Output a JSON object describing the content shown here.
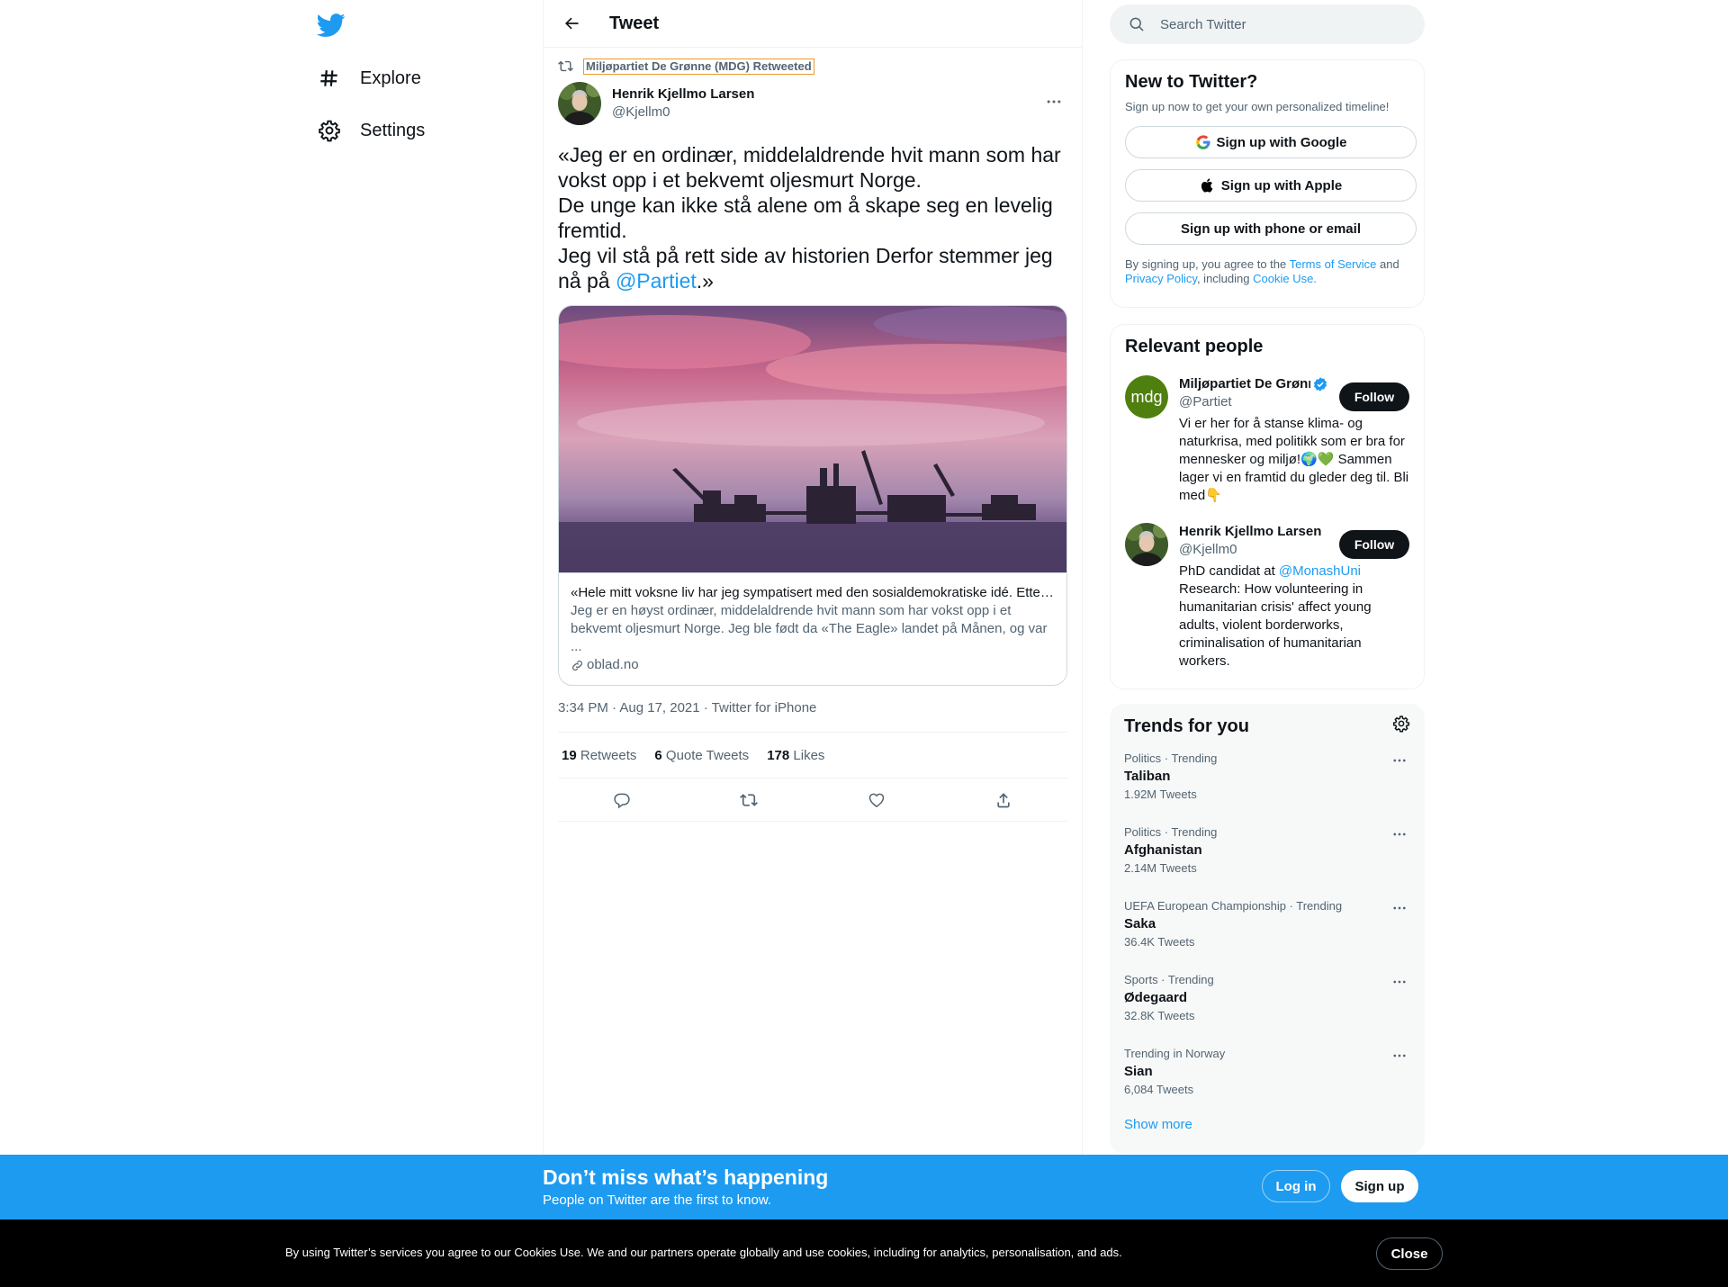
{
  "nav": {
    "explore_label": "Explore",
    "settings_label": "Settings"
  },
  "header": {
    "title": "Tweet"
  },
  "tweet": {
    "retweeted_by": "Miljøpartiet De Grønne (MDG) Retweeted",
    "author_name": "Henrik Kjellmo Larsen",
    "author_handle": "@Kjellm0",
    "text_lines": [
      "«Jeg er en ordinær, middelaldrende hvit mann som har",
      "vokst opp i et bekvemt oljesmurt Norge.",
      "De unge kan ikke stå alene om å skape seg en levelig",
      "fremtid.",
      "Jeg vil stå på rett side av historien Derfor stemmer jeg"
    ],
    "last_line_prefix": "nå på ",
    "mention": "@Partiet",
    "last_line_suffix": ".»",
    "card": {
      "title": "«Hele mitt voksne liv har jeg sympatisert med den sosialdemokratiske idé. Etter...",
      "description_1": "Jeg er en høyst ordinær, middelaldrende hvit mann som har vokst opp i et",
      "description_2": "bekvemt oljesmurt Norge. Jeg ble født da «The Eagle» landet på Månen, og var ...",
      "domain": "oblad.no"
    },
    "timestamp": "3:34 PM · Aug 17, 2021 · Twitter for iPhone",
    "retweets": "19",
    "retweets_label": "Retweets",
    "quotes": "6",
    "quotes_label": "Quote Tweets",
    "likes": "178",
    "likes_label": "Likes"
  },
  "search": {
    "placeholder": "Search Twitter"
  },
  "signup": {
    "title": "New to Twitter?",
    "subtitle": "Sign up now to get your own personalized timeline!",
    "google_label": "Sign up with Google",
    "apple_label": "Sign up with Apple",
    "email_label": "Sign up with phone or email",
    "legal_prefix": "By signing up, you agree to the ",
    "terms_link": "Terms of Service",
    "legal_and": " and ",
    "privacy_link": "Privacy Policy",
    "legal_including": ", including ",
    "cookie_link": "Cookie Use."
  },
  "people": {
    "title": "Relevant people",
    "items": [
      {
        "name": "Miljøpartiet De Grønne",
        "handle": "@Partiet",
        "avatar_text": "mdg",
        "follow_label": "Follow",
        "bio": "Vi er her for å stanse klima- og naturkrisa, med politikk som er bra for mennesker og miljø!🌍💚 Sammen lager vi en framtid du gleder deg til. Bli med👇"
      },
      {
        "name": "Henrik Kjellmo Larsen",
        "handle": "@Kjellm0",
        "follow_label": "Follow",
        "bio_prefix": "PhD candidat at ",
        "bio_mention": "@MonashUni",
        "bio_rest": "Research: How volunteering in humanitarian crisis' affect young adults, violent borderworks, criminalisation of humanitarian workers."
      }
    ]
  },
  "trends": {
    "title": "Trends for you",
    "items": [
      {
        "meta": "Politics · Trending",
        "name": "Taliban",
        "count": "1.92M Tweets"
      },
      {
        "meta": "Politics · Trending",
        "name": "Afghanistan",
        "count": "2.14M Tweets"
      },
      {
        "meta": "UEFA European Championship · Trending",
        "name": "Saka",
        "count": "36.4K Tweets"
      },
      {
        "meta": "Sports · Trending",
        "name": "Ødegaard",
        "count": "32.8K Tweets"
      },
      {
        "meta": "Trending in Norway",
        "name": "Sian",
        "count": "6,084 Tweets"
      }
    ],
    "show_more": "Show more"
  },
  "banner": {
    "title": "Don’t miss what’s happening",
    "subtitle": "People on Twitter are the first to know.",
    "login_label": "Log in",
    "signup_label": "Sign up"
  },
  "cookie": {
    "text": "By using Twitter’s services you agree to our Cookies Use. We and our partners operate globally and use cookies, including for analytics, personalisation, and ads.",
    "close_label": "Close"
  },
  "colors": {
    "brand_blue": "#1d9bf0",
    "text_primary": "#0f1419",
    "text_secondary": "#536471",
    "mdg_green": "#4f7f0f"
  }
}
